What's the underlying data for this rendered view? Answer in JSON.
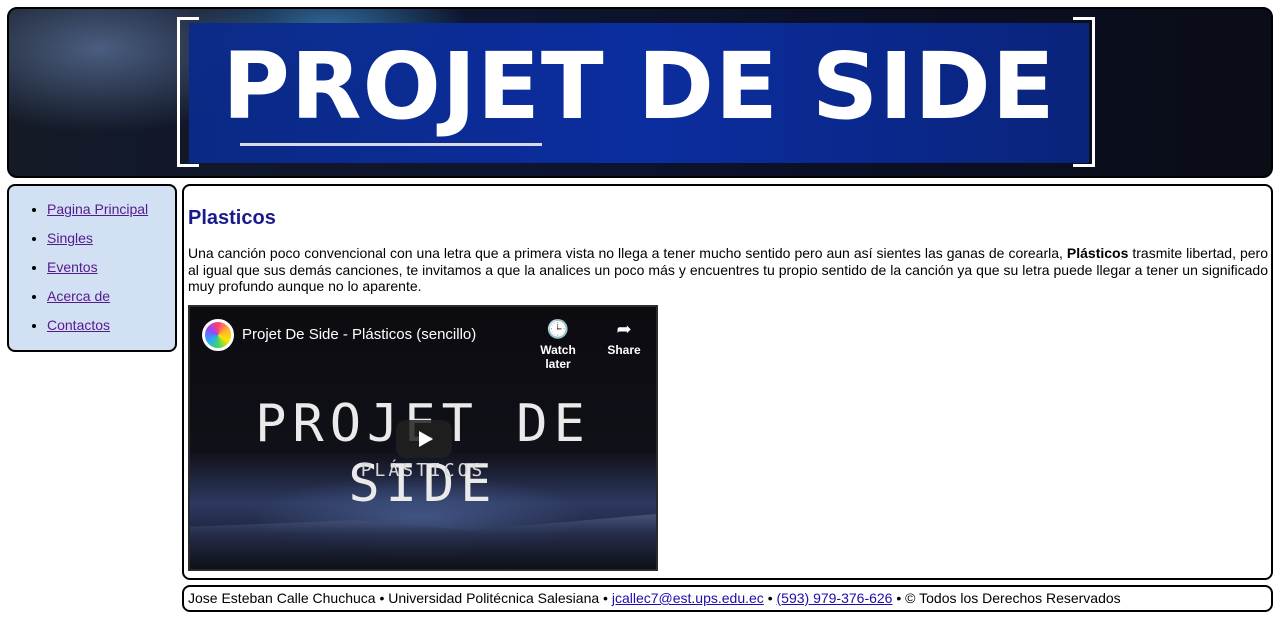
{
  "banner": {
    "title": "PROJET DE SIDE"
  },
  "nav": {
    "items": [
      {
        "label": "Pagina Principal"
      },
      {
        "label": "Singles"
      },
      {
        "label": "Eventos"
      },
      {
        "label": "Acerca de"
      },
      {
        "label": "Contactos"
      }
    ]
  },
  "main": {
    "heading": "Plasticos",
    "desc_before": "Una canción poco convencional con una letra que a primera vista no llega a tener mucho sentido pero aun así sientes las ganas de corearla, ",
    "desc_bold": "Plásticos",
    "desc_after": " trasmite libertad, pero al igual que sus demás canciones, te invitamos a que la analices un poco más y encuentres tu propio sentido de la canción ya que su letra puede llegar a tener un significado muy profundo aunque no lo aparente.",
    "video": {
      "title": "Projet De Side - Plásticos (sencillo)",
      "watch_later": "Watch later",
      "share": "Share",
      "logo_text": "PROJET DE SIDE",
      "sub_text": "PLÁSTICOS"
    }
  },
  "footer": {
    "name": "Jose Esteban Calle Chuchuca",
    "sep1": " • ",
    "university": "Universidad Politécnica Salesiana",
    "sep2": " • ",
    "email": "jcallec7@est.ups.edu.ec",
    "sep3": " • ",
    "phone": "(593) 979-376-626",
    "sep4": " • ",
    "rights": "© Todos los Derechos Reservados"
  },
  "colors": {
    "nav_bg": "#d2e0f3",
    "heading": "#1a1a8f",
    "visited_link": "#551a8b",
    "link": "#1a0dab",
    "banner_panel": "#0b2fa5"
  },
  "icons": {
    "watch_later": "clock-icon",
    "share": "share-arrow-icon",
    "play": "play-icon"
  }
}
